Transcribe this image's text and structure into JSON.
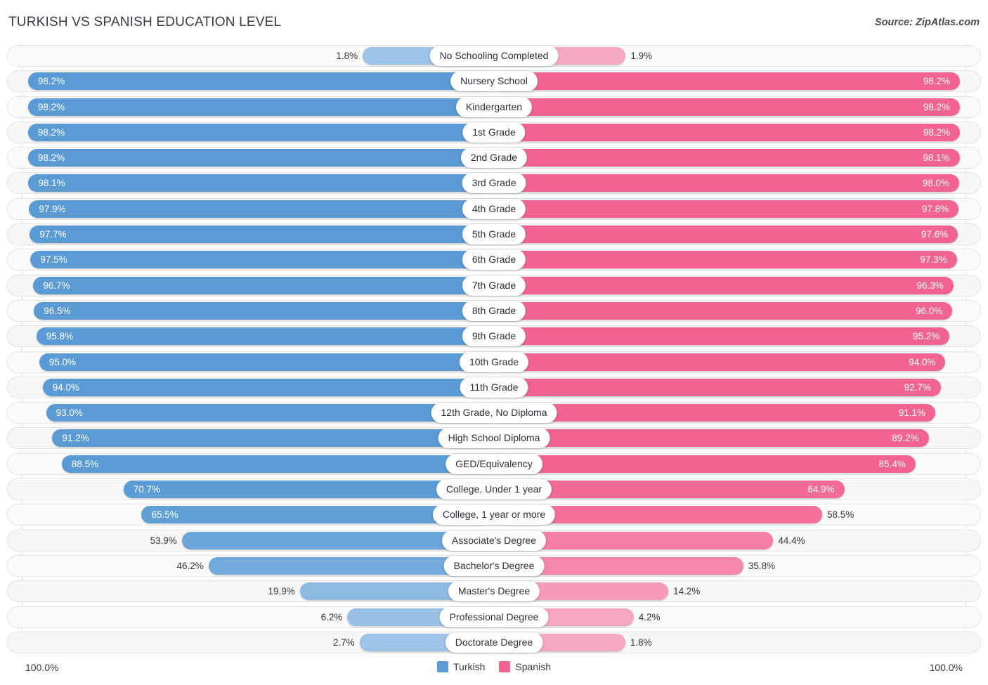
{
  "header": {
    "title": "TURKISH VS SPANISH EDUCATION LEVEL",
    "source": "Source: ZipAtlas.com"
  },
  "footer": {
    "axis_left": "100.0%",
    "axis_right": "100.0%"
  },
  "legend": {
    "items": [
      {
        "label": "Turkish",
        "color": "#5b9bd5"
      },
      {
        "label": "Spanish",
        "color": "#f2638f"
      }
    ]
  },
  "colors": {
    "turkish_full": "#5b9bd5",
    "turkish_light": "#9dc3e6",
    "spanish_full": "#f2638f",
    "spanish_light": "#f7a8c4",
    "track": "#f7f7f7",
    "text_dark": "#35353c",
    "text_light": "#ffffff"
  },
  "chart_data": {
    "type": "bar",
    "title": "TURKISH VS SPANISH EDUCATION LEVEL",
    "orientation": "horizontal-diverging",
    "xlabel": "",
    "ylabel": "",
    "xlim": [
      0,
      100
    ],
    "axis_max_label": "100.0%",
    "grid": false,
    "legend_position": "bottom-center",
    "categories": [
      "No Schooling Completed",
      "Nursery School",
      "Kindergarten",
      "1st Grade",
      "2nd Grade",
      "3rd Grade",
      "4th Grade",
      "5th Grade",
      "6th Grade",
      "7th Grade",
      "8th Grade",
      "9th Grade",
      "10th Grade",
      "11th Grade",
      "12th Grade, No Diploma",
      "High School Diploma",
      "GED/Equivalency",
      "College, Under 1 year",
      "College, 1 year or more",
      "Associate's Degree",
      "Bachelor's Degree",
      "Master's Degree",
      "Professional Degree",
      "Doctorate Degree"
    ],
    "series": [
      {
        "name": "Turkish",
        "color": "#5b9bd5",
        "values": [
          1.8,
          98.2,
          98.2,
          98.2,
          98.2,
          98.1,
          97.9,
          97.7,
          97.5,
          96.7,
          96.5,
          95.8,
          95.0,
          94.0,
          93.0,
          91.2,
          88.5,
          70.7,
          65.5,
          53.9,
          46.2,
          19.9,
          6.2,
          2.7
        ],
        "labels": [
          "1.8%",
          "98.2%",
          "98.2%",
          "98.2%",
          "98.2%",
          "98.1%",
          "97.9%",
          "97.7%",
          "97.5%",
          "96.7%",
          "96.5%",
          "95.8%",
          "95.0%",
          "94.0%",
          "93.0%",
          "91.2%",
          "88.5%",
          "70.7%",
          "65.5%",
          "53.9%",
          "46.2%",
          "19.9%",
          "6.2%",
          "2.7%"
        ]
      },
      {
        "name": "Spanish",
        "color": "#f2638f",
        "values": [
          1.9,
          98.2,
          98.2,
          98.2,
          98.1,
          98.0,
          97.8,
          97.6,
          97.3,
          96.3,
          96.0,
          95.2,
          94.0,
          92.7,
          91.1,
          89.2,
          85.4,
          64.9,
          58.5,
          44.4,
          35.8,
          14.2,
          4.2,
          1.8
        ],
        "labels": [
          "1.9%",
          "98.2%",
          "98.2%",
          "98.2%",
          "98.1%",
          "98.0%",
          "97.8%",
          "97.6%",
          "97.3%",
          "96.3%",
          "96.0%",
          "95.2%",
          "94.0%",
          "92.7%",
          "91.1%",
          "89.2%",
          "85.4%",
          "64.9%",
          "58.5%",
          "44.4%",
          "35.8%",
          "14.2%",
          "4.2%",
          "1.8%"
        ]
      }
    ]
  }
}
